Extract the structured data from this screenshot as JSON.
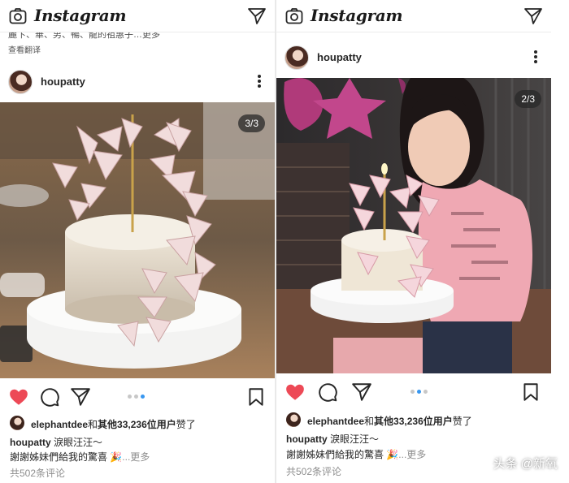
{
  "app": {
    "logo_text": "Instagram"
  },
  "left": {
    "prev_caption": "麗卞、華、男、暢、龍的祖惠子…更多",
    "translate_label": "查看翻译",
    "post": {
      "username": "houpatty",
      "photo_counter": "3/3",
      "liked_by": "elephantdee",
      "likes_mid": "和",
      "likes_rest": "其他33,236位用户",
      "likes_suffix": "赞了",
      "caption_user": "houpatty",
      "caption_text": "淚眼汪汪～",
      "caption_line2": "謝謝姊妹們給我的驚喜 🎉",
      "more_label": "...更多",
      "comments_label": "共502条评论"
    }
  },
  "right": {
    "post": {
      "username": "houpatty",
      "photo_counter": "2/3",
      "liked_by": "elephantdee",
      "likes_mid": "和",
      "likes_rest": "其他33,236位用户",
      "likes_suffix": "赞了",
      "caption_user": "houpatty",
      "caption_text": "淚眼汪汪～",
      "caption_line2": "謝謝姊妹們給我的驚喜 🎉",
      "more_label": "...更多",
      "comments_label": "共502条评论"
    }
  },
  "watermark": "头条 @新氧",
  "colors": {
    "like_red": "#ed4956",
    "carousel_active": "#3897f0",
    "carousel_inactive": "#c7c7c7",
    "muted_text": "#8e8e8e"
  },
  "icons": [
    "camera-icon",
    "direct-message-icon",
    "more-options-icon",
    "heart-icon",
    "comment-icon",
    "share-icon",
    "bookmark-icon"
  ]
}
